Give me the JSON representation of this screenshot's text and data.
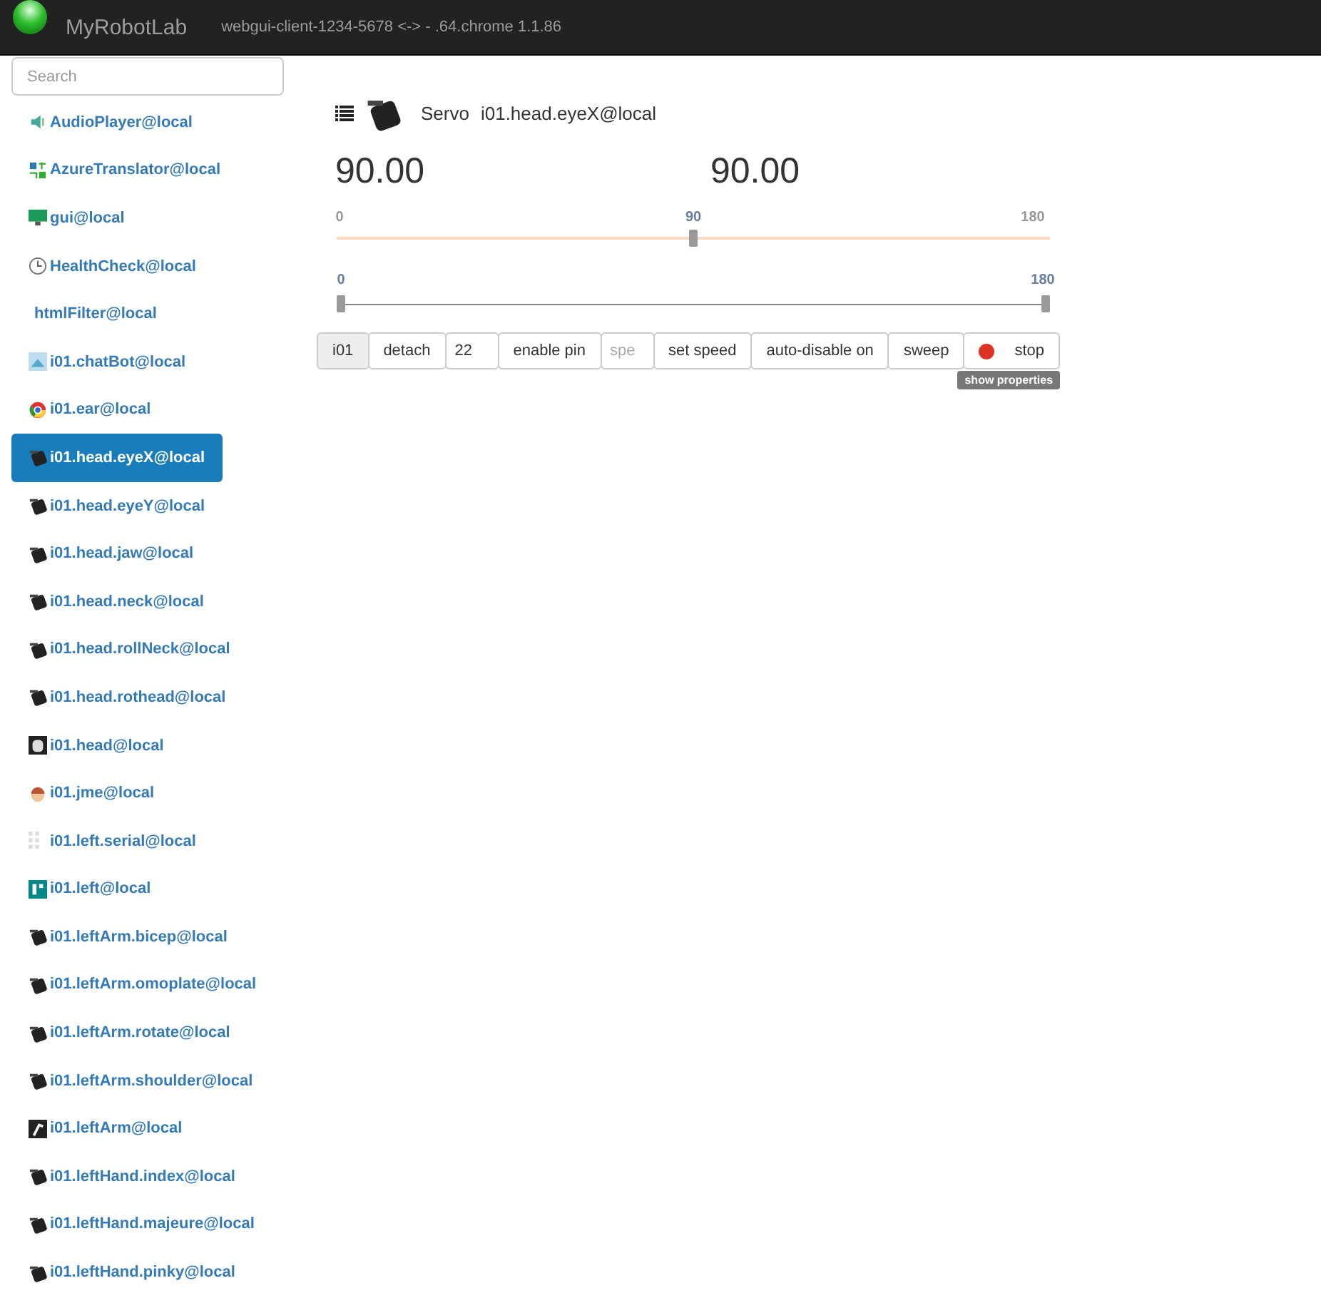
{
  "navbar": {
    "brand": "MyRobotLab",
    "connection": "webgui-client-1234-5678 <-> - .64.chrome 1.1.86"
  },
  "sidebar": {
    "search": {
      "placeholder": "Search"
    },
    "items": [
      {
        "label": "AudioPlayer@local",
        "kind": "audio",
        "selected": false
      },
      {
        "label": "AzureTranslator@local",
        "kind": "translator",
        "selected": false
      },
      {
        "label": "gui@local",
        "kind": "monitor",
        "selected": false
      },
      {
        "label": "HealthCheck@local",
        "kind": "clock",
        "selected": false
      },
      {
        "label": "htmlFilter@local",
        "kind": "plain",
        "selected": false
      },
      {
        "label": "i01.chatBot@local",
        "kind": "chatbot",
        "selected": false
      },
      {
        "label": "i01.ear@local",
        "kind": "chrome",
        "selected": false
      },
      {
        "label": "i01.head.eyeX@local",
        "kind": "servo",
        "selected": true
      },
      {
        "label": "i01.head.eyeY@local",
        "kind": "servo",
        "selected": false
      },
      {
        "label": "i01.head.jaw@local",
        "kind": "servo",
        "selected": false
      },
      {
        "label": "i01.head.neck@local",
        "kind": "servo",
        "selected": false
      },
      {
        "label": "i01.head.rollNeck@local",
        "kind": "servo",
        "selected": false
      },
      {
        "label": "i01.head.rothead@local",
        "kind": "servo",
        "selected": false
      },
      {
        "label": "i01.head@local",
        "kind": "head",
        "selected": false
      },
      {
        "label": "i01.jme@local",
        "kind": "jme",
        "selected": false
      },
      {
        "label": "i01.left.serial@local",
        "kind": "serial",
        "selected": false
      },
      {
        "label": "i01.left@local",
        "kind": "board",
        "selected": false
      },
      {
        "label": "i01.leftArm.bicep@local",
        "kind": "servo",
        "selected": false
      },
      {
        "label": "i01.leftArm.omoplate@local",
        "kind": "servo",
        "selected": false
      },
      {
        "label": "i01.leftArm.rotate@local",
        "kind": "servo",
        "selected": false
      },
      {
        "label": "i01.leftArm.shoulder@local",
        "kind": "servo",
        "selected": false
      },
      {
        "label": "i01.leftArm@local",
        "kind": "arm",
        "selected": false
      },
      {
        "label": "i01.leftHand.index@local",
        "kind": "servo",
        "selected": false
      },
      {
        "label": "i01.leftHand.majeure@local",
        "kind": "servo",
        "selected": false
      },
      {
        "label": "i01.leftHand.pinky@local",
        "kind": "servo",
        "selected": false
      }
    ]
  },
  "panel": {
    "type": "Servo",
    "name": "i01.head.eyeX@local",
    "readings": [
      "90.00",
      "90.00"
    ],
    "position_slider": {
      "min": "0",
      "value": "90",
      "max": "180",
      "level": 0.5
    },
    "limits_slider": {
      "thumbs": [
        {
          "label": "0",
          "level": 0
        },
        {
          "label": "180",
          "level": 1
        }
      ]
    },
    "controls": [
      {
        "kind": "addon",
        "label": "i01"
      },
      {
        "kind": "button",
        "label": "detach"
      },
      {
        "kind": "input",
        "value": "22"
      },
      {
        "kind": "button",
        "label": "enable pin"
      },
      {
        "kind": "input",
        "placeholder": "spe"
      },
      {
        "kind": "button",
        "label": "set speed"
      },
      {
        "kind": "button",
        "label": "auto-disable on"
      },
      {
        "kind": "button",
        "label": "sweep"
      },
      {
        "kind": "stop",
        "label": "stop"
      }
    ],
    "properties_badge": "show properties"
  }
}
